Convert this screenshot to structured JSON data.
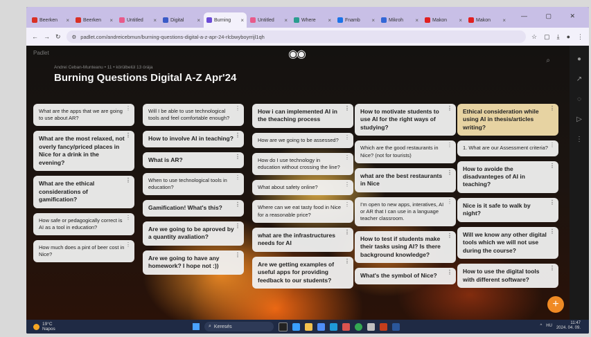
{
  "browser": {
    "tabs": [
      {
        "label": "Beerken",
        "icon": "gmail-icon",
        "color": "#d93025",
        "active": false
      },
      {
        "label": "Beerken",
        "icon": "gmail-icon",
        "color": "#d93025",
        "active": false
      },
      {
        "label": "Untitled",
        "icon": "padlet-icon",
        "color": "#e85a8a",
        "active": false
      },
      {
        "label": "Digital",
        "icon": "doc-icon",
        "color": "#3a5bc7",
        "active": false
      },
      {
        "label": "Burning",
        "icon": "padlet-icon",
        "color": "#6b4bd6",
        "active": true
      },
      {
        "label": "Untitled",
        "icon": "padlet-icon",
        "color": "#e85a8a",
        "active": false
      },
      {
        "label": "Where",
        "icon": "globe-icon",
        "color": "#2a9d8f",
        "active": false
      },
      {
        "label": "Fnamb",
        "icon": "blue-circle-icon",
        "color": "#1a73e8",
        "active": false
      },
      {
        "label": "Mikroh",
        "icon": "box-icon",
        "color": "#3367d6",
        "active": false
      },
      {
        "label": "Makon",
        "icon": "youtube-icon",
        "color": "#e02020",
        "active": false
      },
      {
        "label": "Makon",
        "icon": "youtube-icon",
        "color": "#e02020",
        "active": false
      }
    ],
    "url": "padlet.com/andreicebmun/burning-questions-digital-a-z-apr-24-rlcbwyboyrrijl1qh",
    "window_controls": "— ▢ ✕"
  },
  "board": {
    "logo": "Padlet",
    "meta": "Andrei Ceban-Munteanu • 11 • körülbelül 13 órája",
    "title": "Burning Questions Digital A-Z Apr'24"
  },
  "columns": [
    [
      {
        "text": "What are the apps that we are going to use about AR?",
        "bold": false,
        "tan": false
      },
      {
        "text": "What are the most relaxed, not overly fancy/priced places in Nice for a drink in the evening?",
        "bold": true,
        "tan": false
      },
      {
        "text": "What are the ethical considerations of gamification?",
        "bold": true,
        "tan": false
      },
      {
        "text": "How safe or pedagogically correct is AI as a tool in education?",
        "bold": false,
        "tan": false
      },
      {
        "text": "How much does a pint of beer cost in Nice?",
        "bold": false,
        "tan": false
      }
    ],
    [
      {
        "text": "Will I be able to use technological tools and feel comfortable enough?",
        "bold": false,
        "tan": false
      },
      {
        "text": "How to involve AI in teaching?",
        "bold": true,
        "tan": false
      },
      {
        "text": "What is AR?",
        "bold": true,
        "tan": false
      },
      {
        "text": "When to use technological tools in education?",
        "bold": false,
        "tan": false
      },
      {
        "text": "Gamification! What's this?",
        "bold": true,
        "tan": false
      },
      {
        "text": "Are we going to be aproved by a quantity avaliation?",
        "bold": true,
        "tan": false
      },
      {
        "text": "Are we going to have any homework? I hope not :))",
        "bold": true,
        "tan": false
      }
    ],
    [
      {
        "text": "How i can implemented AI in the theaching process",
        "bold": true,
        "tan": false
      },
      {
        "text": "How are we going to be assessed?",
        "bold": false,
        "tan": false
      },
      {
        "text": "How do I use technology in education without crossing the line?",
        "bold": false,
        "tan": false
      },
      {
        "text": "What about safety online?",
        "bold": false,
        "tan": false
      },
      {
        "text": "Where can we eat tasty food in Nice for a reasonable price?",
        "bold": false,
        "tan": false
      },
      {
        "text": "what are the infrastructures needs for AI",
        "bold": true,
        "tan": false
      },
      {
        "text": "Are we getting examples of useful apps for providing feedback to our students?",
        "bold": true,
        "tan": false
      }
    ],
    [
      {
        "text": "How to motivate students to use AI for the right ways of studying?",
        "bold": true,
        "tan": false
      },
      {
        "text": "Which are the good restaurants in Nice? (not for tourists)",
        "bold": false,
        "tan": false
      },
      {
        "text": "what are the best restaurants in Nice",
        "bold": true,
        "tan": false
      },
      {
        "text": "I'm open to new apps, interatives, AI or AR that I can use in a language teacher classroom.",
        "bold": false,
        "tan": false
      },
      {
        "text": "How to test if students make their tasks using AI? Is there background knowledge?",
        "bold": true,
        "tan": false
      },
      {
        "text": "What's the symbol of Nice?",
        "bold": true,
        "tan": false
      }
    ],
    [
      {
        "text": "Ethical consideration while using AI in thesis/articles writing?",
        "bold": true,
        "tan": true
      },
      {
        "text": "1. What are our Assessment criteria?",
        "bold": false,
        "tan": false
      },
      {
        "text": "How to avoide the disadvanteges of AI in teaching?",
        "bold": true,
        "tan": false
      },
      {
        "text": "Nice is it safe to walk by night?",
        "bold": true,
        "tan": false
      },
      {
        "text": "Will we know any other digital tools which we will not use during the course?",
        "bold": true,
        "tan": false
      },
      {
        "text": "How to use the digital tools with different software?",
        "bold": true,
        "tan": false
      }
    ]
  ],
  "taskbar": {
    "weather_temp": "19°C",
    "weather_desc": "Napos",
    "search_label": "Keresés",
    "tray_lang": "HU",
    "time": "11:47",
    "date": "2024. 04. 09."
  },
  "icons": {
    "more": "⋮",
    "back": "←",
    "forward": "→",
    "reload": "↻",
    "search": "⌕",
    "star": "☆",
    "plus": "+"
  }
}
